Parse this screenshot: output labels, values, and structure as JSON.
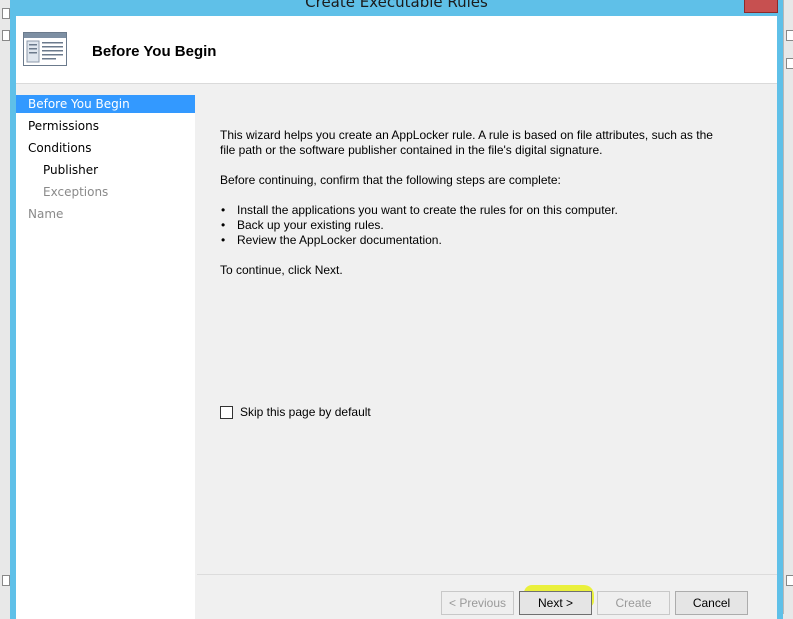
{
  "window": {
    "title": "Create Executable Rules"
  },
  "header": {
    "title": "Before You Begin",
    "icon": "wizard-page-icon"
  },
  "nav": {
    "items": [
      {
        "label": "Before You Begin",
        "state": "selected"
      },
      {
        "label": "Permissions",
        "state": "normal"
      },
      {
        "label": "Conditions",
        "state": "normal"
      },
      {
        "label": "Publisher",
        "state": "normal"
      },
      {
        "label": "Exceptions",
        "state": "disabled"
      },
      {
        "label": "Name",
        "state": "disabled"
      }
    ]
  },
  "content": {
    "intro": "This wizard helps you create an AppLocker rule. A rule is based on file attributes, such as the file path or the software publisher contained in the file's digital signature.",
    "confirm": "Before continuing, confirm that the following steps are complete:",
    "steps": [
      "Install the applications you want to create the rules for on this computer.",
      "Back up your existing rules.",
      "Review the AppLocker documentation."
    ],
    "continue": "To continue, click Next.",
    "skip_label": "Skip this page by default",
    "skip_checked": false
  },
  "buttons": {
    "previous": "< Previous",
    "next": "Next >",
    "create": "Create",
    "cancel": "Cancel"
  },
  "colors": {
    "frame": "#5fc0e8",
    "selection": "#3399ff",
    "highlight": "#e8f000"
  }
}
